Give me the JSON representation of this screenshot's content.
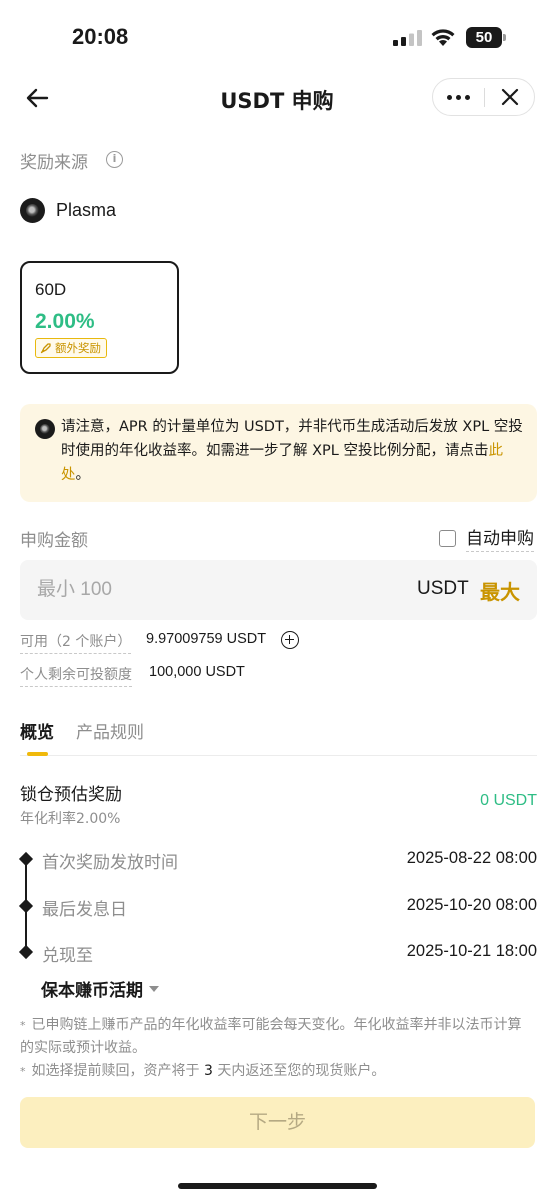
{
  "status_bar": {
    "time": "20:08",
    "battery": "50",
    "battery_level": 0.5
  },
  "nav": {
    "title": "USDT 申购"
  },
  "reward_source": {
    "label": "奖励来源",
    "name": "Plasma"
  },
  "term_card": {
    "duration": "60D",
    "apr": "2.00%",
    "badge": "额外奖励"
  },
  "notice": {
    "text": "请注意，APR 的计量单位为 USDT，并非代币生成活动后发放 XPL 空投时使用的年化收益率。如需进一步了解 XPL 空投比例分配，请点击",
    "link": "此处",
    "suffix": "。"
  },
  "subscribe": {
    "label": "申购金额",
    "auto_label": "自动申购",
    "auto_checked": false,
    "placeholder": "最小 100",
    "unit": "USDT",
    "max_label": "最大"
  },
  "available": {
    "label": "可用（2 个账户）",
    "value": "9.97009759 USDT"
  },
  "quota": {
    "label": "个人剩余可投额度",
    "value": "100,000 USDT"
  },
  "tabs": [
    {
      "label": "概览",
      "active": true
    },
    {
      "label": "产品规则",
      "active": false
    }
  ],
  "reward": {
    "title": "锁仓预估奖励",
    "sub": "年化利率2.00%",
    "value": "0 USDT"
  },
  "timeline": [
    {
      "label": "首次奖励发放时间",
      "value": "2025-08-22 08:00"
    },
    {
      "label": "最后发息日",
      "value": "2025-10-20 08:00"
    },
    {
      "label": "兑现至",
      "value": "2025-10-21 18:00"
    }
  ],
  "redeem_to": "保本赚币活期",
  "footnotes": {
    "first": "已申购链上赚币产品的年化收益率可能会每天变化。年化收益率并非以法币计算的实际或预计收益。",
    "second_prefix": "如选择提前赎回，资产将于",
    "second_bold": "3",
    "second_suffix": "天内返还至您的现货账户。"
  },
  "next_button": "下一步",
  "colors": {
    "accent": "#f0b90b",
    "link": "#c99400",
    "positive": "#2ebd85",
    "notice_bg": "#fdf6e3",
    "disabled_button": "#fcefbf"
  }
}
